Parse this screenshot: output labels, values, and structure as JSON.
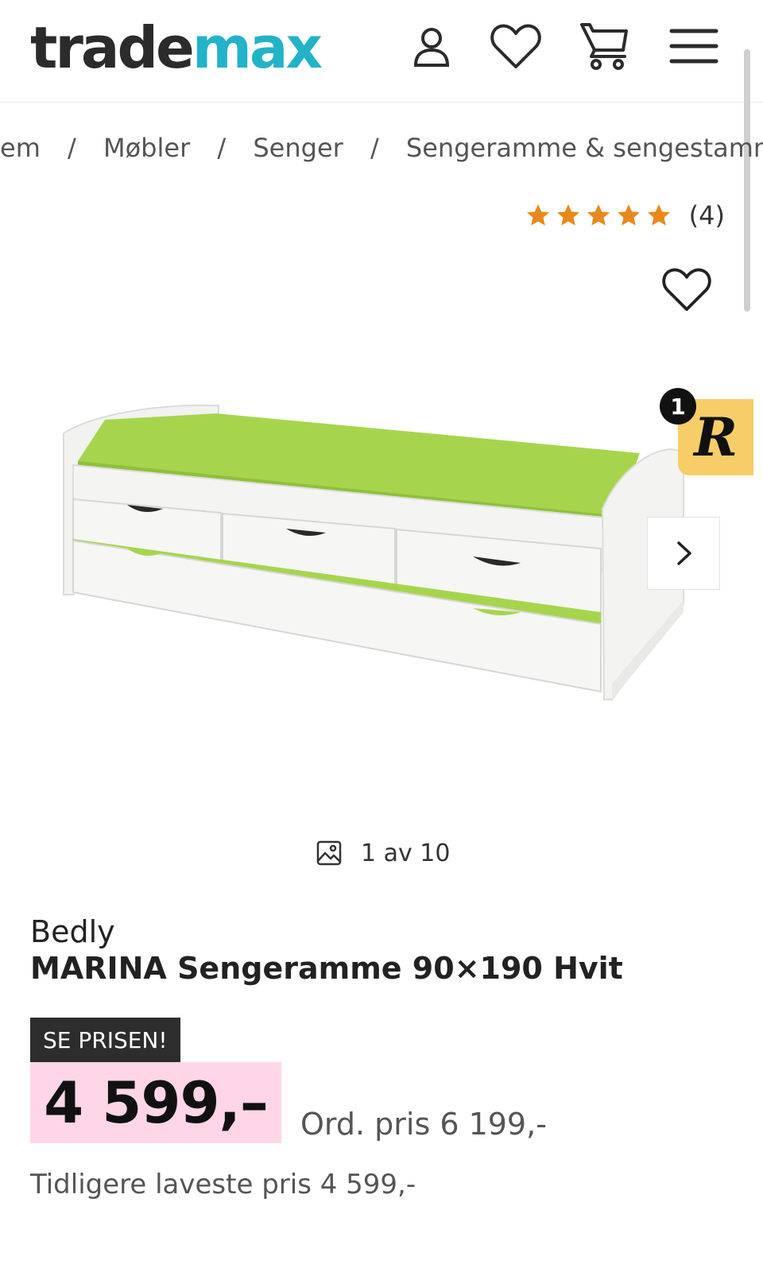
{
  "header": {
    "logo_part1": "trade",
    "logo_part2": "max",
    "icons": [
      "user-icon",
      "heart-icon",
      "cart-icon",
      "menu-icon"
    ]
  },
  "breadcrumb": {
    "items": [
      "em",
      "Møbler",
      "Senger",
      "Sengeramme & sengestamme"
    ],
    "separator": "/"
  },
  "rating": {
    "stars": 5,
    "count_label": "(4)",
    "star_color": "#e8891c"
  },
  "gallery": {
    "badge_count": "1",
    "badge_letter": "R",
    "counter": "1 av 10"
  },
  "product": {
    "brand": "Bedly",
    "title": "MARINA Sengeramme 90×190 Hvit"
  },
  "pricing": {
    "sale_tag": "SE PRISEN!",
    "price": "4 599,–",
    "ordinary_price": "Ord. pris 6 199,-",
    "previous_lowest": "Tidligere laveste pris 4 599,-"
  },
  "colors": {
    "brand_teal": "#22b3c8",
    "price_bg": "#ffd6e7",
    "badge_yellow": "#f7cd68"
  }
}
